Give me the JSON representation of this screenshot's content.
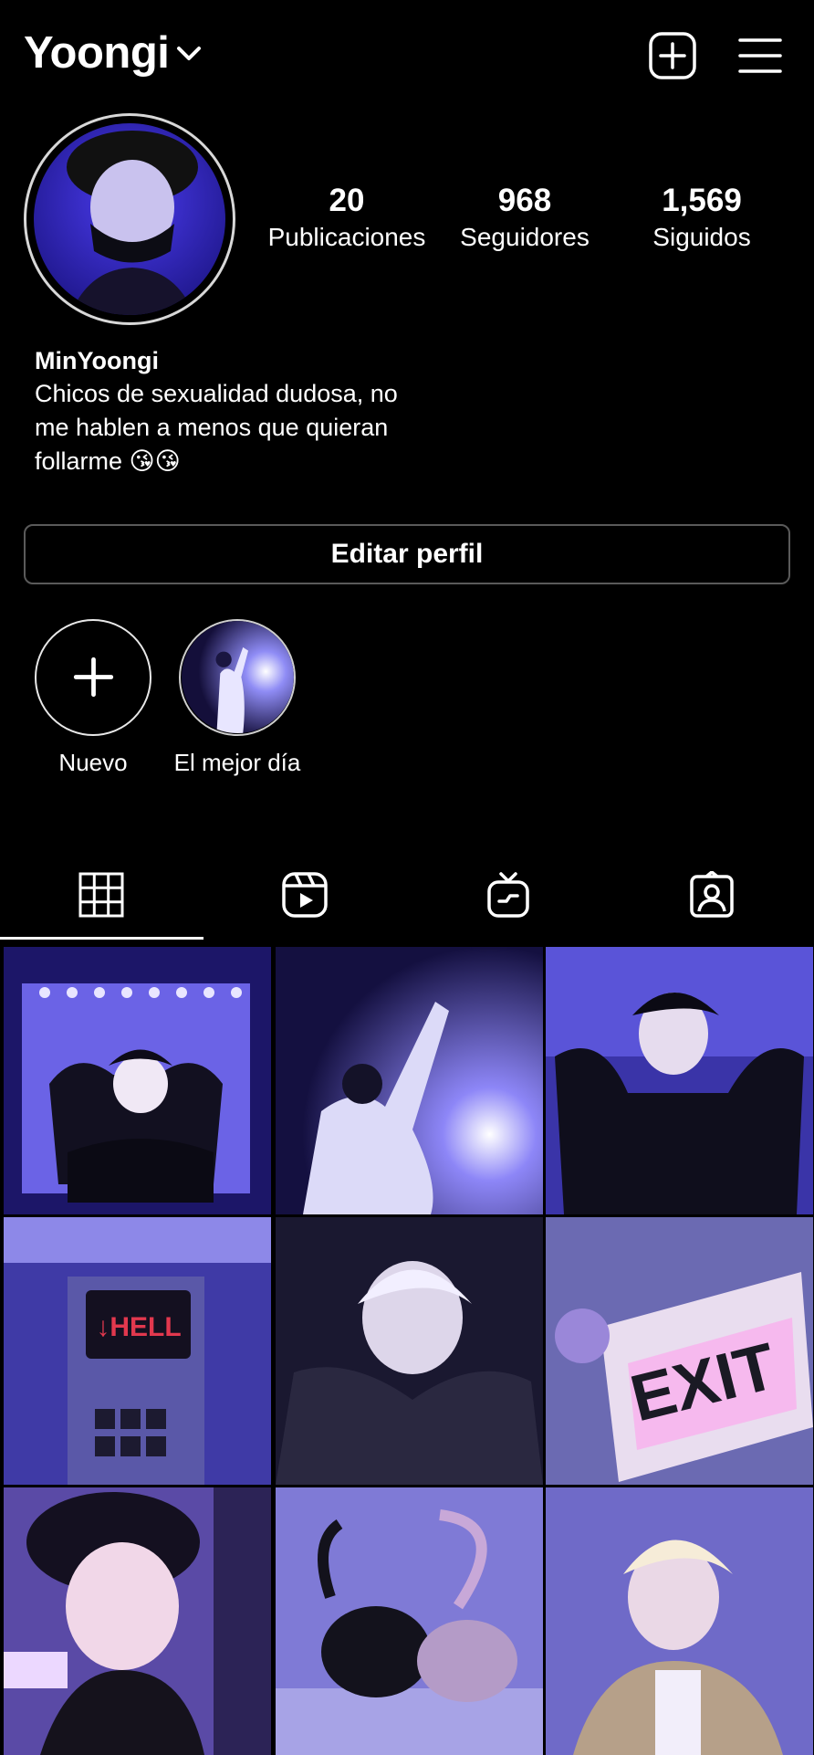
{
  "header": {
    "username": "Yoongi",
    "icons": {
      "dropdown": "chevron-down-icon",
      "create": "add-post-icon",
      "menu": "hamburger-menu-icon"
    }
  },
  "profile": {
    "stats": [
      {
        "value": "20",
        "label": "Publicaciones"
      },
      {
        "value": "968",
        "label": "Seguidores"
      },
      {
        "value": "1,569",
        "label": "Siguidos"
      }
    ],
    "bio_name": "MinYoongi",
    "bio_text": "Chicos de sexualidad dudosa, no\nme hablen a menos que quieran\nfollarme 😘😘"
  },
  "edit_button": "Editar perfil",
  "highlights": [
    {
      "label": "Nuevo"
    },
    {
      "label": "El mejor día"
    }
  ],
  "tabs": [
    {
      "name": "posts-grid",
      "icon": "grid-icon",
      "active": true
    },
    {
      "name": "reels",
      "icon": "reels-icon",
      "active": false
    },
    {
      "name": "igtv",
      "icon": "igtv-icon",
      "active": false
    },
    {
      "name": "tagged",
      "icon": "tagged-person-icon",
      "active": false
    }
  ],
  "colors": {
    "background": "#000000",
    "text": "#ffffff",
    "border": "#5a5a5a",
    "accent_purple": "#5a4fd6"
  }
}
